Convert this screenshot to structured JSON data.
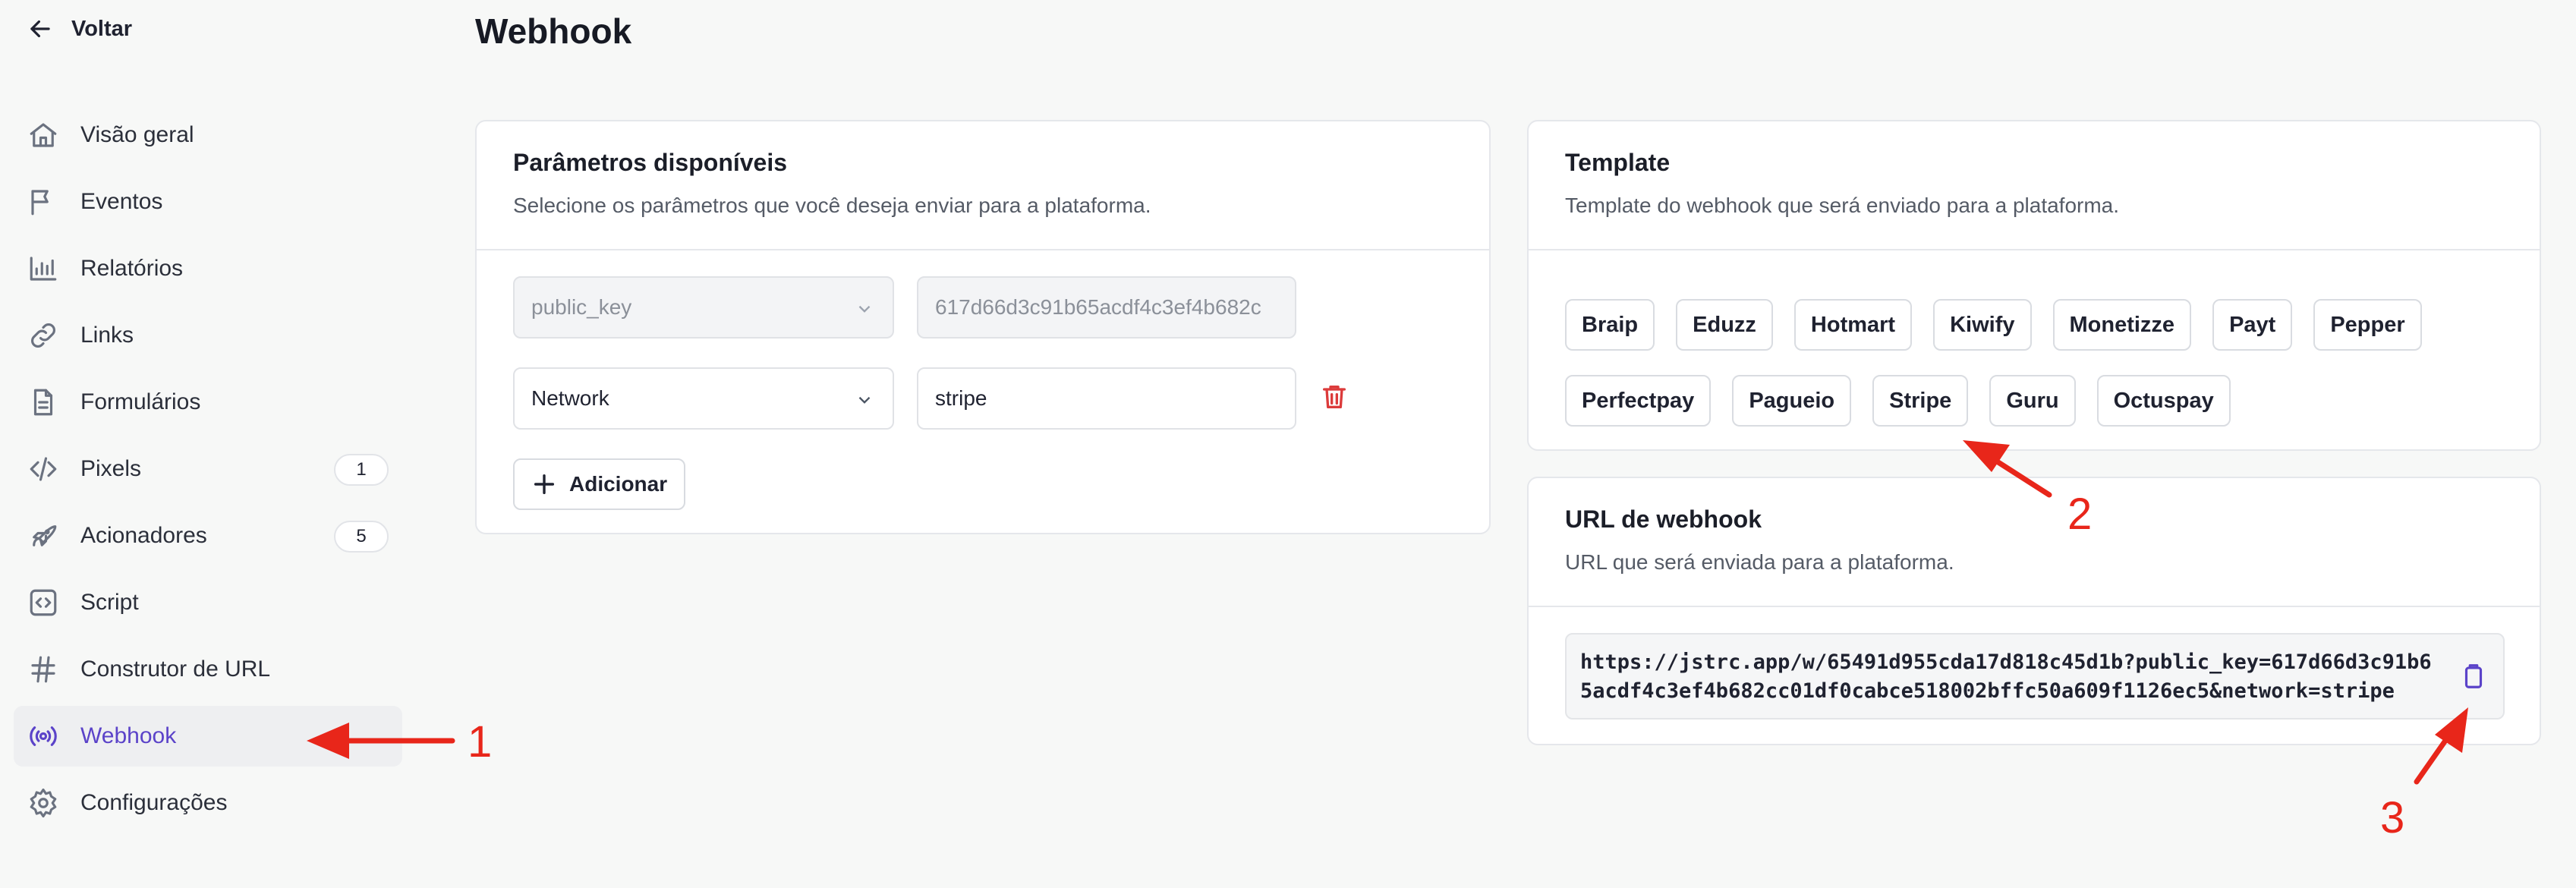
{
  "back": {
    "label": "Voltar"
  },
  "page": {
    "title": "Webhook"
  },
  "sidebar": {
    "items": [
      {
        "label": "Visão geral",
        "icon": "home-icon"
      },
      {
        "label": "Eventos",
        "icon": "flag-icon"
      },
      {
        "label": "Relatórios",
        "icon": "chart-icon"
      },
      {
        "label": "Links",
        "icon": "link-icon"
      },
      {
        "label": "Formulários",
        "icon": "document-icon"
      },
      {
        "label": "Pixels",
        "icon": "code-icon",
        "badge": "1"
      },
      {
        "label": "Acionadores",
        "icon": "rocket-icon",
        "badge": "5"
      },
      {
        "label": "Script",
        "icon": "script-icon"
      },
      {
        "label": "Construtor de URL",
        "icon": "hash-icon"
      },
      {
        "label": "Webhook",
        "icon": "broadcast-icon",
        "active": true
      },
      {
        "label": "Configurações",
        "icon": "gear-icon"
      }
    ]
  },
  "params": {
    "title": "Parâmetros disponíveis",
    "subtitle": "Selecione os parâmetros que você deseja enviar para a plataforma.",
    "rows": [
      {
        "select": "public_key",
        "value": "617d66d3c91b65acdf4c3ef4b682c",
        "disabled": true
      },
      {
        "select": "Network",
        "value": "stripe",
        "disabled": false
      }
    ],
    "add_label": "Adicionar"
  },
  "template": {
    "title": "Template",
    "subtitle": "Template do webhook que será enviado para a plataforma.",
    "options": [
      "Braip",
      "Eduzz",
      "Hotmart",
      "Kiwify",
      "Monetizze",
      "Payt",
      "Pepper",
      "Perfectpay",
      "Pagueio",
      "Stripe",
      "Guru",
      "Octuspay"
    ]
  },
  "url": {
    "title": "URL de webhook",
    "subtitle": "URL que será enviada para a plataforma.",
    "value": "https://jstrc.app/w/65491d955cda17d818c45d1b?public_key=617d66d3c91b65acdf4c3ef4b682cc01df0cabce518002bffc50a609f1126ec5&network=stripe"
  },
  "annotations": {
    "one": "1",
    "two": "2",
    "three": "3",
    "color": "#e8261a"
  }
}
